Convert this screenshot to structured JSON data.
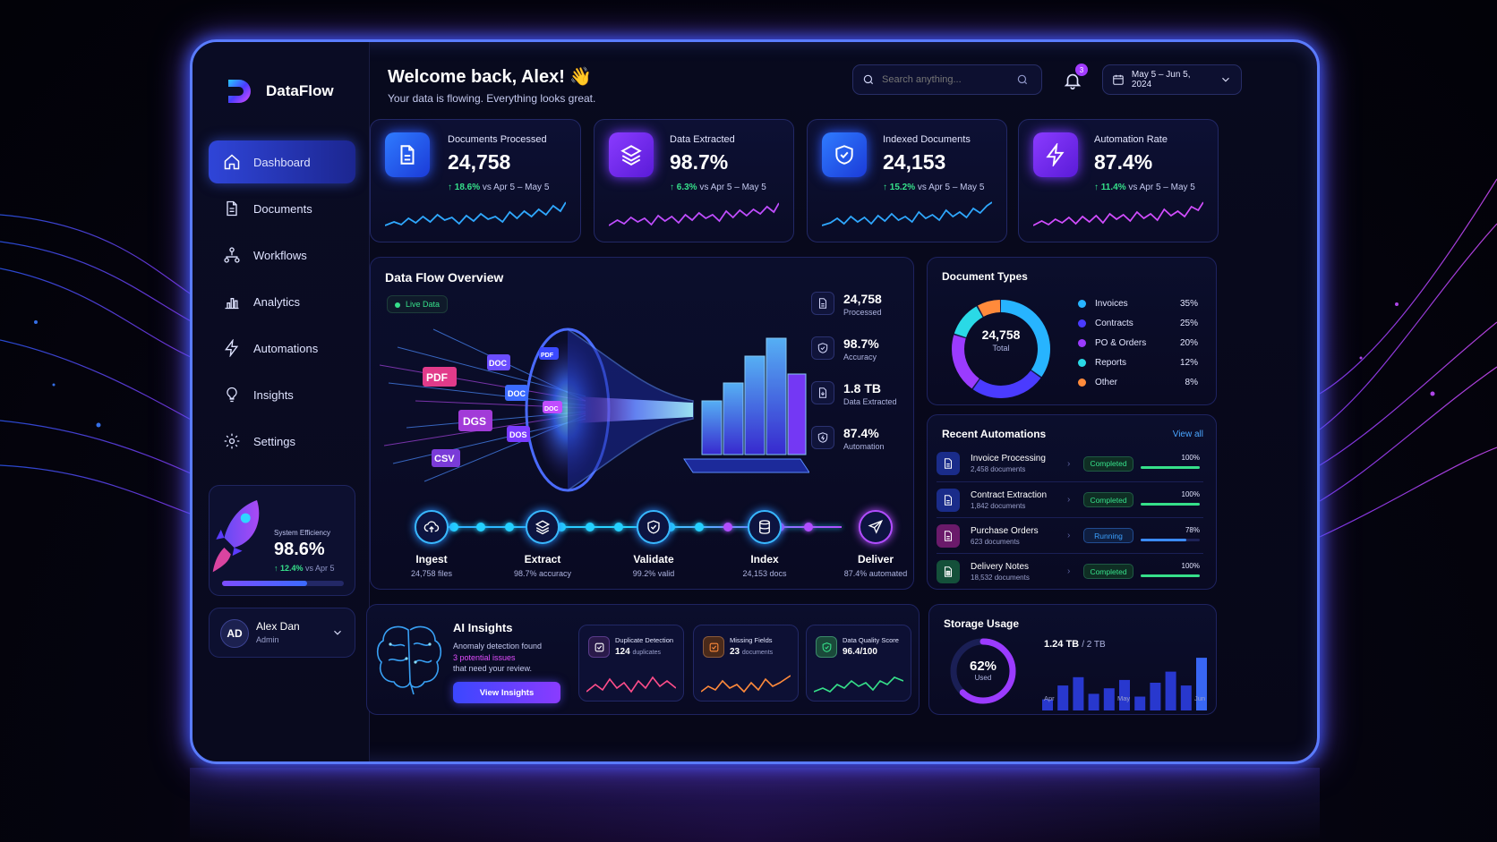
{
  "brand": {
    "name": "DataFlow"
  },
  "sidebar": {
    "items": [
      {
        "label": "Dashboard",
        "icon": "home-icon",
        "active": true
      },
      {
        "label": "Documents",
        "icon": "document-icon"
      },
      {
        "label": "Workflows",
        "icon": "workflow-icon"
      },
      {
        "label": "Analytics",
        "icon": "analytics-icon"
      },
      {
        "label": "Automations",
        "icon": "lightning-icon"
      },
      {
        "label": "Insights",
        "icon": "lightbulb-icon"
      },
      {
        "label": "Settings",
        "icon": "gear-icon"
      }
    ],
    "efficiency": {
      "label": "System Efficiency",
      "value": "98.6%",
      "delta": "↑ 12.4%",
      "delta_suffix": "vs Apr 5",
      "progress": 0.7
    },
    "user": {
      "initials": "AD",
      "name": "Alex Dan",
      "role": "Admin"
    }
  },
  "header": {
    "welcome": "Welcome back, Alex! 👋",
    "subtitle": "Your data is flowing. Everything looks great.",
    "search_placeholder": "Search anything...",
    "notifications": "3",
    "date_range": "May 5 – Jun 5, 2024"
  },
  "stats": [
    {
      "title": "Documents Processed",
      "value": "24,758",
      "delta": "↑ 18.6%",
      "period": "vs Apr 5 – May 5",
      "icon": "document-icon",
      "color": "#2f7bff"
    },
    {
      "title": "Data Extracted",
      "value": "98.7%",
      "delta": "↑ 6.3%",
      "period": "vs Apr 5 – May 5",
      "icon": "layers-icon",
      "color": "#8a3bff"
    },
    {
      "title": "Indexed Documents",
      "value": "24,153",
      "delta": "↑ 15.2%",
      "period": "vs Apr 5 – May 5",
      "icon": "shield-check-icon",
      "color": "#2f7bff"
    },
    {
      "title": "Automation Rate",
      "value": "87.4%",
      "delta": "↑ 11.4%",
      "period": "vs Apr 5 – May 5",
      "icon": "lightning-icon",
      "color": "#8a3bff"
    }
  ],
  "flow": {
    "title": "Data Flow Overview",
    "live": "Live Data",
    "file_tags": [
      "PDF",
      "DOC",
      "DGS",
      "CSV",
      "DOC",
      "PDF",
      "DOC",
      "DOS"
    ],
    "stats": [
      {
        "value": "24,758",
        "label": "Processed",
        "icon": "document-icon"
      },
      {
        "value": "98.7%",
        "label": "Accuracy",
        "icon": "shield-check-icon"
      },
      {
        "value": "1.8 TB",
        "label": "Data Extracted",
        "icon": "export-doc-icon"
      },
      {
        "value": "87.4%",
        "label": "Automation",
        "icon": "automation-shield-icon"
      }
    ],
    "steps": [
      {
        "name": "Ingest",
        "sub": "24,758 files",
        "icon": "cloud-upload-icon"
      },
      {
        "name": "Extract",
        "sub": "98.7% accuracy",
        "icon": "layers-icon"
      },
      {
        "name": "Validate",
        "sub": "99.2% valid",
        "icon": "shield-check-icon"
      },
      {
        "name": "Index",
        "sub": "24,153 docs",
        "icon": "database-icon"
      },
      {
        "name": "Deliver",
        "sub": "87.4% automated",
        "icon": "send-icon"
      }
    ]
  },
  "doc_types": {
    "title": "Document Types",
    "total": "24,758",
    "total_label": "Total",
    "items": [
      {
        "name": "Invoices",
        "pct": "35%",
        "value": 35,
        "color": "#27b4ff"
      },
      {
        "name": "Contracts",
        "pct": "25%",
        "value": 25,
        "color": "#4a3bff"
      },
      {
        "name": "PO & Orders",
        "pct": "20%",
        "value": 20,
        "color": "#9b3bff"
      },
      {
        "name": "Reports",
        "pct": "12%",
        "value": 12,
        "color": "#2ad9e6"
      },
      {
        "name": "Other",
        "pct": "8%",
        "value": 8,
        "color": "#ff8a3b"
      }
    ]
  },
  "automations": {
    "title": "Recent Automations",
    "view_all": "View all",
    "items": [
      {
        "name": "Invoice Processing",
        "sub": "2,458 documents",
        "status": "Completed",
        "pct": "100%",
        "value": 1.0,
        "color": "#3b6bff",
        "icon": "document-icon"
      },
      {
        "name": "Contract Extraction",
        "sub": "1,842 documents",
        "status": "Completed",
        "pct": "100%",
        "value": 1.0,
        "color": "#3b6bff",
        "icon": "document-icon"
      },
      {
        "name": "Purchase Orders",
        "sub": "623 documents",
        "status": "Running",
        "pct": "78%",
        "value": 0.78,
        "color": "#c43bb4",
        "icon": "document-icon"
      },
      {
        "name": "Delivery Notes",
        "sub": "18,532 documents",
        "status": "Completed",
        "pct": "100%",
        "value": 1.0,
        "color": "#2fa86a",
        "icon": "spreadsheet-icon"
      }
    ]
  },
  "ai": {
    "title": "AI Insights",
    "desc_1": "Anomaly detection found",
    "desc_hl": "3 potential issues",
    "desc_2": "that need your review.",
    "button": "View Insights",
    "cards": [
      {
        "title": "Duplicate Detection",
        "value": "124",
        "unit": "duplicates",
        "icon": "check-square-icon",
        "color": "#ff4d8a"
      },
      {
        "title": "Missing Fields",
        "value": "23",
        "unit": "documents",
        "icon": "warning-icon",
        "color": "#ff8a3b"
      },
      {
        "title": "Data Quality Score",
        "value": "96.4/100",
        "unit": "",
        "icon": "shield-check-icon",
        "color": "#36e08a"
      }
    ]
  },
  "storage": {
    "title": "Storage Usage",
    "pct": "62%",
    "value": 0.62,
    "used_label": "Used",
    "used": "1.24 TB",
    "total": "/ 2 TB",
    "months": [
      "Apr",
      "May",
      "Jun"
    ],
    "bars": [
      0.2,
      0.45,
      0.6,
      0.3,
      0.4,
      0.55,
      0.25,
      0.5,
      0.7,
      0.45,
      0.95
    ]
  }
}
